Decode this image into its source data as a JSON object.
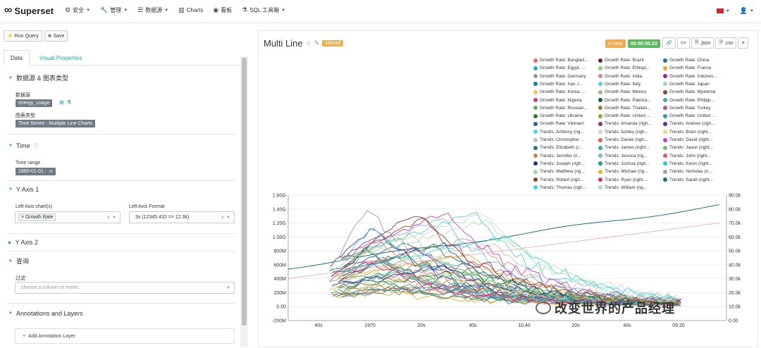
{
  "navbar": {
    "brand": "Superset",
    "menu": [
      {
        "label": "安全",
        "icon": "gear-icon",
        "caret": true
      },
      {
        "label": "管理",
        "icon": "wrench-icon",
        "caret": true
      },
      {
        "label": "数据源",
        "icon": "database-icon",
        "caret": true
      },
      {
        "label": "Charts",
        "icon": "bar-chart-icon",
        "caret": false
      },
      {
        "label": "看板",
        "icon": "dashboard-icon",
        "caret": false
      },
      {
        "label": "SQL 工具箱",
        "icon": "flask-icon",
        "caret": true
      }
    ]
  },
  "toolbar": {
    "run_query": "Run Query",
    "save": "Save"
  },
  "tabs": {
    "data": "Data",
    "visual": "Visual Properties"
  },
  "sections": {
    "datasource": "数据源 & 图表类型",
    "datasource_label": "数据源",
    "datasource_value": "energy_usage",
    "viz_label": "图表类型",
    "viz_value": "Time Series - Multiple Line Charts",
    "time": "Time",
    "time_range_label": "Time range",
    "time_range_value": "1960-01-01 :",
    "yaxis1": "Y Axis 1",
    "left_axis_chart_label": "Left Axis chart(s)",
    "left_axis_chart_value": "Growth Rate",
    "left_axis_format_label": "Left Axis Format",
    "left_axis_format_value": "3s (12345.432 => 12.3k)",
    "yaxis2": "Y Axis 2",
    "query": "查询",
    "filter_label": "过滤",
    "filter_placeholder": "choose a column or metric",
    "annotations": "Annotations and Layers",
    "add_annotation": "Add Annotation Layer"
  },
  "chart": {
    "title": "Multi Line",
    "altered": "Altered",
    "rows": "0 rows",
    "timer": "00:00:00.23",
    "json": ".json",
    "csv": ".csv"
  },
  "legend": [
    {
      "label": "Growth Rate: Banglad...",
      "color": "#ef6a6a"
    },
    {
      "label": "Growth Rate: Brazil",
      "color": "#6b1f3a"
    },
    {
      "label": "Growth Rate: China",
      "color": "#1e6e8c"
    },
    {
      "label": "Growth Rate: Egypt, ...",
      "color": "#1fb5b5"
    },
    {
      "label": "Growth Rate: Ethiopi...",
      "color": "#8bd36b"
    },
    {
      "label": "Growth Rate: France",
      "color": "#f5a623"
    },
    {
      "label": "Growth Rate: Germany",
      "color": "#9a9a9a"
    },
    {
      "label": "Growth Rate: India",
      "color": "#ef7aa0"
    },
    {
      "label": "Growth Rate: Indones...",
      "color": "#9b1f9b"
    },
    {
      "label": "Growth Rate: Iran, I...",
      "color": "#1a7aa8"
    },
    {
      "label": "Growth Rate: Italy",
      "color": "#4fd1d9"
    },
    {
      "label": "Growth Rate: Japan",
      "color": "#a4dca4"
    },
    {
      "label": "Growth Rate: Korea, ...",
      "color": "#f5c06b"
    },
    {
      "label": "Growth Rate: Mexico",
      "color": "#b5a38b"
    },
    {
      "label": "Growth Rate: Myanmar",
      "color": "#7d4c2a"
    },
    {
      "label": "Growth Rate: Nigeria",
      "color": "#e0338a"
    },
    {
      "label": "Growth Rate: Pakista...",
      "color": "#1a5c3c"
    },
    {
      "label": "Growth Rate: Philipp...",
      "color": "#3ab0a0"
    },
    {
      "label": "Growth Rate: Russian...",
      "color": "#5cb85c"
    },
    {
      "label": "Growth Rate: Thailan...",
      "color": "#a07a2e"
    },
    {
      "label": "Growth Rate: Turkey",
      "color": "#b5529e"
    },
    {
      "label": "Growth Rate: Ukraine",
      "color": "#2e7a2e"
    },
    {
      "label": "Growth Rate: United ...",
      "color": "#a0a02e"
    },
    {
      "label": "Growth Rate: United ...",
      "color": "#2e9ea0"
    },
    {
      "label": "Growth Rate: Vietnam",
      "color": "#2e5f9e"
    },
    {
      "label": "Trends: Amanda (righ...",
      "color": "#9e2e6e"
    },
    {
      "label": "Trends: Andrew (righ...",
      "color": "#5a2e9e"
    },
    {
      "label": "Trends: Anthony (rig...",
      "color": "#4dd9e0"
    },
    {
      "label": "Trends: Ashley (righ...",
      "color": "#c0e0c0"
    },
    {
      "label": "Trends: Brian (right...",
      "color": "#f5d08b"
    },
    {
      "label": "Trends: Christopher ...",
      "color": "#c0c0c0"
    },
    {
      "label": "Trends: Daniel (righ...",
      "color": "#ef5a5a"
    },
    {
      "label": "Trends: David (right...",
      "color": "#d13ad1"
    },
    {
      "label": "Trends: Elizabeth (r...",
      "color": "#1a7a7a"
    },
    {
      "label": "Trends: James (right...",
      "color": "#2eb5a0"
    },
    {
      "label": "Trends: Jason (right...",
      "color": "#6bc26b"
    },
    {
      "label": "Trends: Jennifer (ri...",
      "color": "#c09040"
    },
    {
      "label": "Trends: Jessica (rig...",
      "color": "#7ab5d9"
    },
    {
      "label": "Trends: John (right...",
      "color": "#ef4a8a"
    },
    {
      "label": "Trends: Joseph (righ...",
      "color": "#1a3a8a"
    },
    {
      "label": "Trends: Joshua (righ...",
      "color": "#1e9e9e"
    },
    {
      "label": "Trends: Kevin (right...",
      "color": "#2ec9c9"
    },
    {
      "label": "Trends: Matthew (rig...",
      "color": "#9ed99e"
    },
    {
      "label": "Trends: Michael (rig...",
      "color": "#f0b429"
    },
    {
      "label": "Trends: Nicholas (ri...",
      "color": "#b59e8a"
    },
    {
      "label": "Trends: Robert (righ...",
      "color": "#8a4a1a"
    },
    {
      "label": "Trends: Ryan (right ...",
      "color": "#d62e7a"
    },
    {
      "label": "Trends: Sarah (right...",
      "color": "#1a6a7a"
    },
    {
      "label": "Trends: Thomas (righ...",
      "color": "#3ad9d9"
    },
    {
      "label": "Trends: William (rig...",
      "color": "#b0e0b0"
    }
  ],
  "chart_data": {
    "type": "line",
    "left_ticks": [
      "1.60G",
      "1.40G",
      "1.20G",
      "1.00G",
      "800M",
      "600M",
      "400M",
      "200M",
      "0.00",
      "-200M"
    ],
    "right_ticks": [
      "90.0k",
      "80.0k",
      "70.0k",
      "60.0k",
      "50.0k",
      "40.0k",
      "30.0k",
      "20.0k",
      "10.0k",
      "0.00"
    ],
    "x_ticks": [
      "40s",
      "1970",
      "20s",
      "40s",
      "10:40",
      "20s",
      "40s",
      "09:20"
    ],
    "ylim_left": [
      -200,
      1600
    ],
    "ylim_right": [
      0,
      90000
    ]
  },
  "watermark": "改变世界的产品经理"
}
